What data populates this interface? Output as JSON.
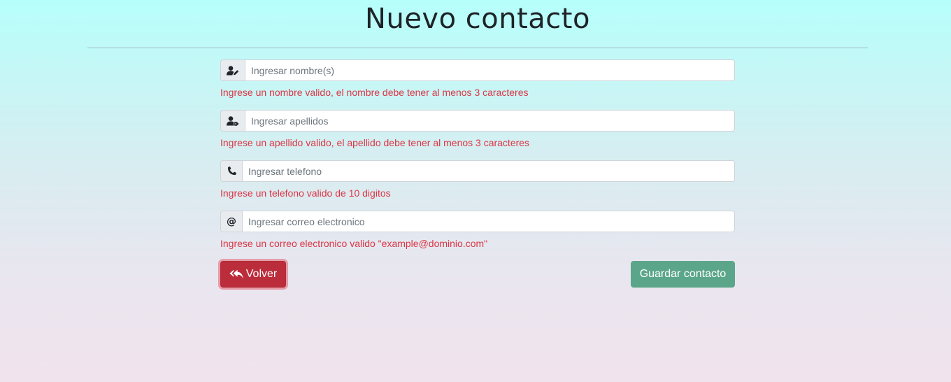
{
  "page": {
    "title": "Nuevo contacto"
  },
  "form": {
    "nombre": {
      "icon": "user-edit-icon",
      "placeholder": "Ingresar nombre(s)",
      "value": "",
      "error": "Ingrese un nombre valido, el nombre debe tener al menos 3 caracteres"
    },
    "apellidos": {
      "icon": "user-tag-icon",
      "placeholder": "Ingresar apellidos",
      "value": "",
      "error": "Ingrese un apellido valido, el apellido debe tener al menos 3 caracteres"
    },
    "telefono": {
      "icon": "phone-icon",
      "placeholder": "Ingresar telefono",
      "value": "",
      "error": "Ingrese un telefono valido de 10 digitos"
    },
    "correo": {
      "icon": "at-icon",
      "glyph": "@",
      "placeholder": "Ingresar correo electronico",
      "value": "",
      "error": "Ingrese un correo electronico valido \"example@dominio.com\""
    }
  },
  "actions": {
    "back_label": "Volver",
    "back_icon": "reply-all-icon",
    "save_label": "Guardar contacto"
  },
  "colors": {
    "danger": "#dc3545",
    "back_button": "#bb2d3b",
    "save_button": "#5ba68a"
  }
}
